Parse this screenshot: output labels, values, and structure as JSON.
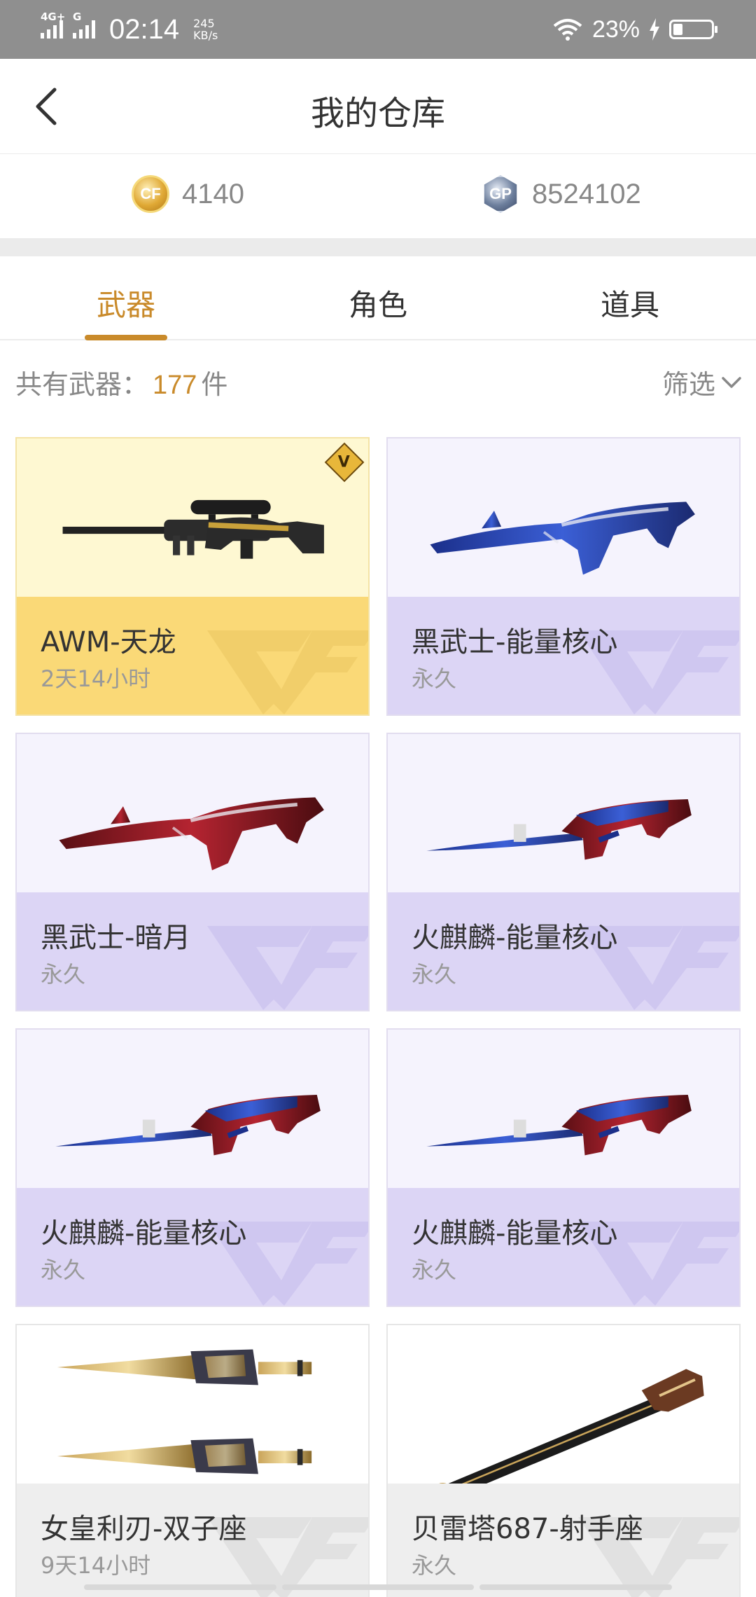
{
  "status_bar": {
    "network1": "4G+",
    "network2": "G",
    "time": "02:14",
    "speed_value": "245",
    "speed_unit": "KB/s",
    "battery": "23%"
  },
  "header": {
    "title": "我的仓库",
    "back_icon": "chevron-left-icon"
  },
  "currency": {
    "cf_points": "4140",
    "gp_points": "8524102",
    "cf_coin_label": "CF",
    "gp_coin_label": "GP"
  },
  "tabs": [
    {
      "label": "武器",
      "active": true
    },
    {
      "label": "角色",
      "active": false
    },
    {
      "label": "道具",
      "active": false
    }
  ],
  "summary": {
    "prefix": "共有武器：",
    "count": "177",
    "unit": "件",
    "filter_label": "筛选"
  },
  "colors": {
    "accent": "#c98a2a",
    "gold_card": "#fad977",
    "purple_card": "#dcd5f5",
    "grey_card": "#eeeeee"
  },
  "items": [
    {
      "name": "AWM-天龙",
      "duration": "2天14小时",
      "theme": "gold",
      "weapon": "sniper",
      "badge": "V"
    },
    {
      "name": "黑武士-能量核心",
      "duration": "永久",
      "theme": "purple",
      "weapon": "rifle-blue"
    },
    {
      "name": "黑武士-暗月",
      "duration": "永久",
      "theme": "purple",
      "weapon": "rifle-red"
    },
    {
      "name": "火麒麟-能量核心",
      "duration": "永久",
      "theme": "purple",
      "weapon": "ak-blade"
    },
    {
      "name": "火麒麟-能量核心",
      "duration": "永久",
      "theme": "purple",
      "weapon": "ak-blade"
    },
    {
      "name": "火麒麟-能量核心",
      "duration": "永久",
      "theme": "purple",
      "weapon": "ak-blade"
    },
    {
      "name": "女皇利刃-双子座",
      "duration": "9天14小时",
      "theme": "grey",
      "weapon": "twin-blades"
    },
    {
      "name": "贝雷塔687-射手座",
      "duration": "永久",
      "theme": "grey",
      "weapon": "shotgun"
    }
  ]
}
